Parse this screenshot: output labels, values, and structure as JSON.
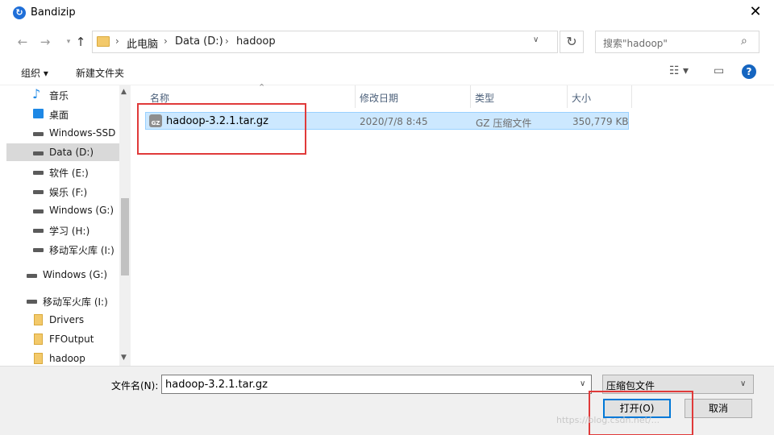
{
  "window": {
    "title": "Bandizip",
    "app_icon": "bandizip-logo-icon",
    "close_icon": "close-icon"
  },
  "nav": {
    "back_icon": "arrow-left-icon",
    "forward_icon": "arrow-right-icon",
    "up_icon": "arrow-up-icon",
    "breadcrumb": [
      "此电脑",
      "Data (D:)",
      "hadoop"
    ],
    "search_placeholder": "搜索\"hadoop\"",
    "refresh_icon": "refresh-icon",
    "search_icon": "search-icon"
  },
  "toolbar": {
    "organize_label": "组织",
    "new_folder_label": "新建文件夹",
    "view_icon": "view-options-icon",
    "preview_icon": "preview-pane-icon",
    "help_icon": "help-icon"
  },
  "sidebar": {
    "items": [
      {
        "label": "音乐",
        "icon": "music-icon"
      },
      {
        "label": "桌面",
        "icon": "desktop-icon"
      },
      {
        "label": "Windows-SSD",
        "icon": "drive-icon"
      },
      {
        "label": "Data (D:)",
        "icon": "drive-icon",
        "selected": true
      },
      {
        "label": "软件 (E:)",
        "icon": "drive-icon"
      },
      {
        "label": "娱乐 (F:)",
        "icon": "drive-icon"
      },
      {
        "label": "Windows (G:)",
        "icon": "drive-icon"
      },
      {
        "label": "学习 (H:)",
        "icon": "drive-icon"
      },
      {
        "label": "移动军火库 (I:)",
        "icon": "usb-drive-icon"
      },
      {
        "label": "Windows (G:)",
        "icon": "drive-icon"
      },
      {
        "label": "移动军火库 (I:)",
        "icon": "usb-drive-icon"
      },
      {
        "label": "Drivers",
        "icon": "folder-icon"
      },
      {
        "label": "FFOutput",
        "icon": "folder-icon"
      },
      {
        "label": "hadoop",
        "icon": "folder-icon"
      }
    ]
  },
  "files": {
    "columns": [
      "名称",
      "修改日期",
      "类型",
      "大小"
    ],
    "rows": [
      {
        "name": "hadoop-3.2.1.tar.gz",
        "modified": "2020/7/8 8:45",
        "type": "GZ 压缩文件",
        "size": "350,779 KB",
        "icon": "gz-archive-icon"
      }
    ]
  },
  "footer": {
    "filename_label": "文件名(N):",
    "filename_value": "hadoop-3.2.1.tar.gz",
    "filetype_value": "压缩包文件",
    "open_label": "打开(O)",
    "cancel_label": "取消"
  },
  "annotations": {
    "highlight_color": "#e03a3a"
  },
  "watermark": "https://blog.csdn.net/..."
}
